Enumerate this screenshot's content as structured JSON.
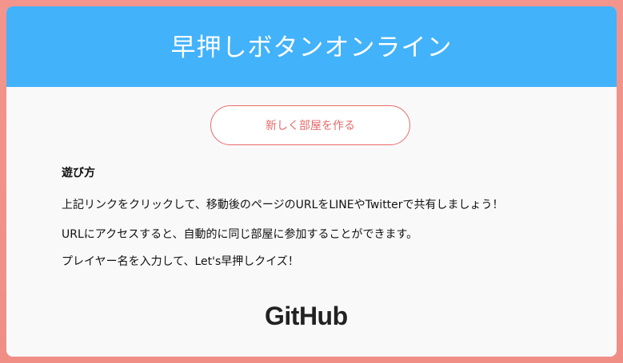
{
  "header": {
    "title": "早押しボタンオンライン"
  },
  "main": {
    "create_room_label": "新しく部屋を作る",
    "howto": {
      "heading": "遊び方",
      "paragraphs": [
        "上記リンクをクリックして、移動後のページのURLをLINEやTwitterで共有しましょう！",
        "URLにアクセスすると、自動的に同じ部屋に参加することができます。",
        "プレイヤー名を入力して、Let's早押しクイズ！"
      ]
    }
  },
  "footer": {
    "github_label": "GitHub"
  },
  "colors": {
    "background": "#f3958c",
    "header": "#42b2fb",
    "button_accent": "#e56b6b"
  }
}
